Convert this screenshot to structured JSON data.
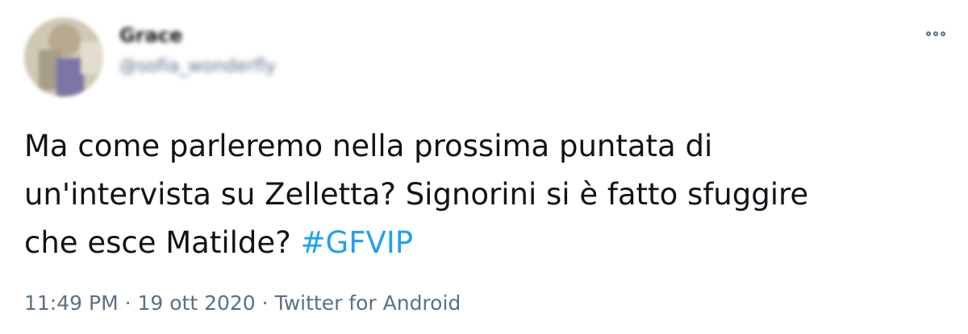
{
  "author": {
    "display_name": "Grace",
    "handle": "@sofia_wonderfly"
  },
  "tweet": {
    "line1": "Ma come parleremo nella prossima puntata di",
    "line2": "un'intervista su Zelletta? Signorini si è fatto sfuggire",
    "line3_text": "che esce Matilde? ",
    "hashtag": "#GFVIP"
  },
  "meta": {
    "time": "11:49 PM",
    "separator1": " · ",
    "date": "19 ott 2020",
    "separator2": " · ",
    "source": "Twitter for Android"
  },
  "icons": {
    "more": "more-options-icon"
  },
  "colors": {
    "text": "#0f1419",
    "secondary": "#5b7083",
    "hashtag": "#1da1f2"
  }
}
